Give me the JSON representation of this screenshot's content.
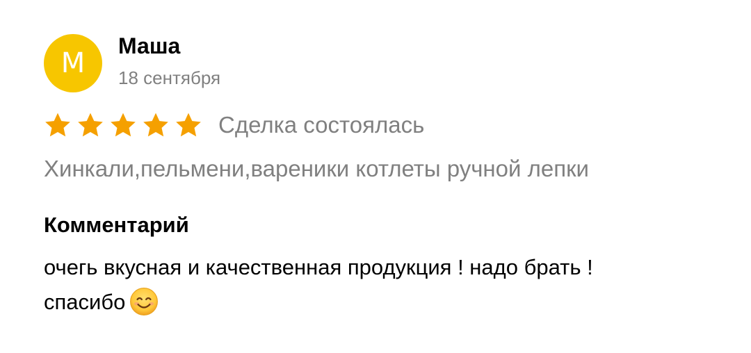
{
  "review": {
    "avatar_letter": "М",
    "author_name": "Маша",
    "date": "18 сентября",
    "rating": {
      "value": 5,
      "max": 5,
      "star_color": "#f5a000"
    },
    "deal_status": "Сделка состоялась",
    "product_title": "Хинкали,пельмени,вареники котлеты ручной лепки",
    "comment_heading": "Комментарий",
    "comment_text": "очегь вкусная и качественная продукция ! надо брать ! спасибо",
    "comment_emoji": "smiling-face-icon"
  },
  "colors": {
    "avatar_bg": "#f7c600",
    "secondary_text": "#808080",
    "primary_text": "#000000"
  }
}
